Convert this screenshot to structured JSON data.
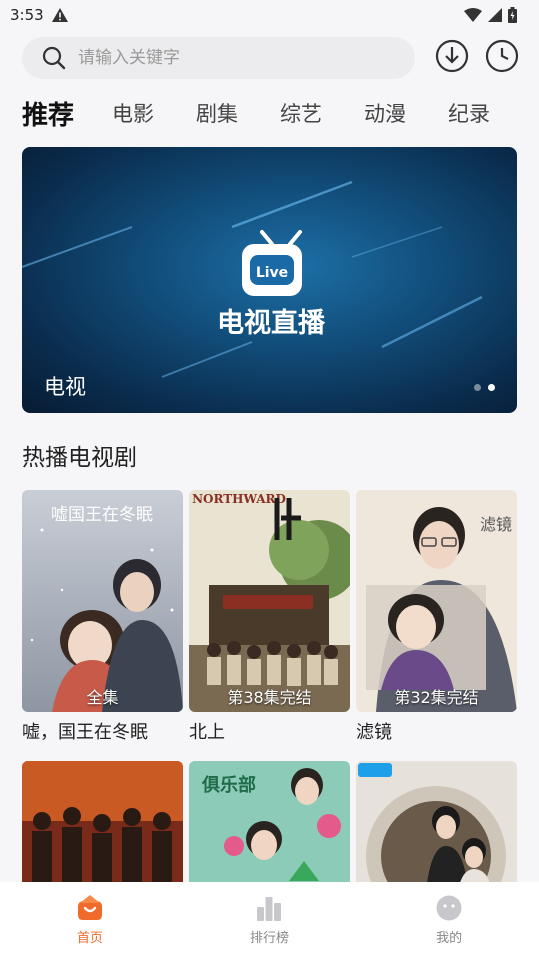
{
  "status_bar": {
    "time": "3:53"
  },
  "search": {
    "placeholder": "请输入关键字"
  },
  "tabs": [
    "推荐",
    "电影",
    "剧集",
    "综艺",
    "动漫",
    "纪录"
  ],
  "banner": {
    "live_label": "Live",
    "image_text": "电视直播",
    "caption": "电视"
  },
  "section": {
    "title": "热播电视剧"
  },
  "shows": [
    {
      "title": "嘘，国王在冬眠",
      "badge": "全集",
      "poster_text": "嘘国王在冬眠"
    },
    {
      "title": "北上",
      "badge": "第38集完结",
      "poster_text": "NORTHWARD"
    },
    {
      "title": "滤镜",
      "badge": "第32集完结",
      "poster_text": "滤镜"
    },
    {
      "title": "",
      "badge": "",
      "poster_text": ""
    },
    {
      "title": "",
      "badge": "",
      "poster_text": "俱乐部"
    },
    {
      "title": "",
      "badge": "",
      "poster_text": ""
    }
  ],
  "bottom_nav": [
    {
      "label": "首页",
      "icon": "home-icon",
      "active": true
    },
    {
      "label": "排行榜",
      "icon": "ranking-icon",
      "active": false
    },
    {
      "label": "我的",
      "icon": "profile-icon",
      "active": false
    }
  ],
  "colors": {
    "accent": "#f06a2a",
    "banner": "#12507e"
  }
}
